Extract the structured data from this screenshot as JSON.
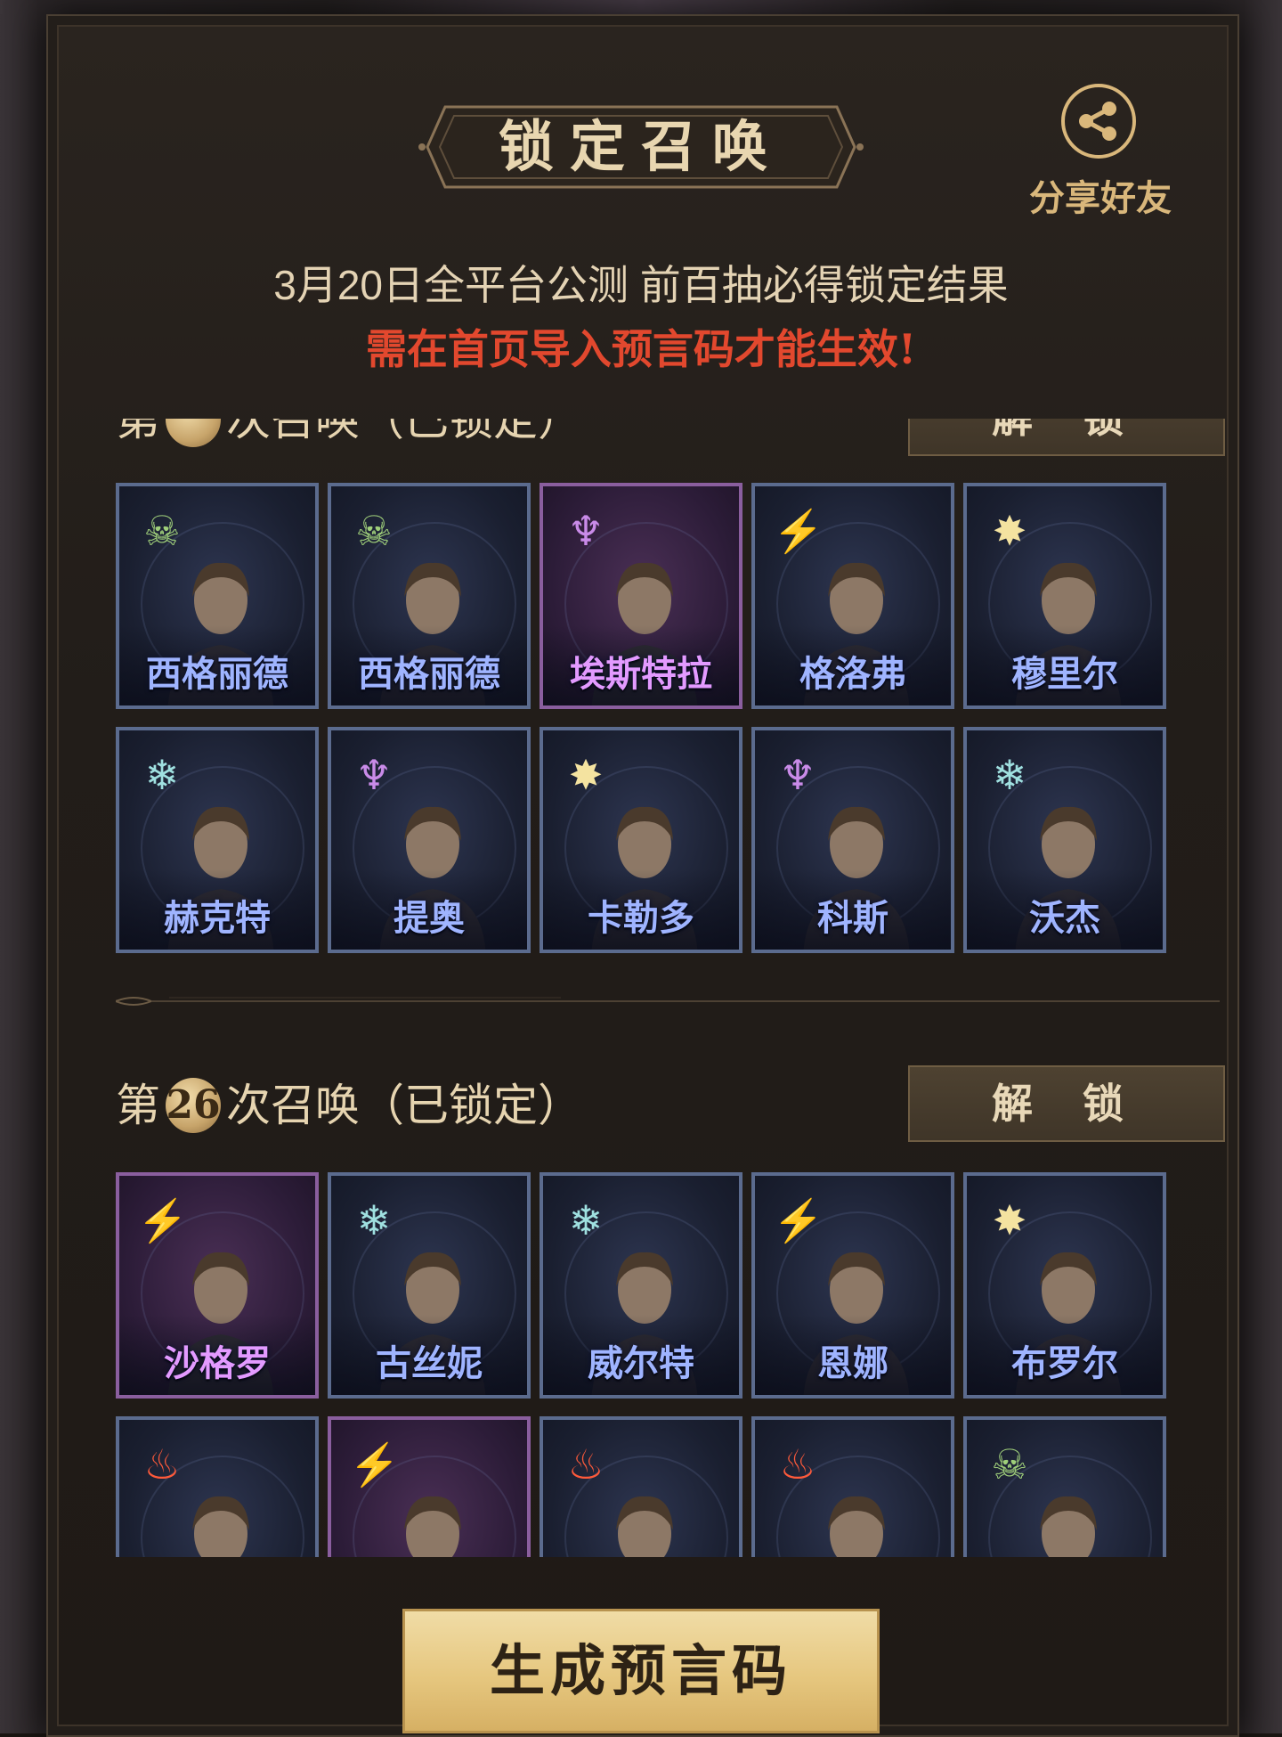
{
  "header": {
    "title": "锁定召唤",
    "share_label": "分享好友",
    "subtitle": "3月20日全平台公测 前百抽必得锁定结果",
    "notice": "需在首页导入预言码才能生效!"
  },
  "sections": [
    {
      "prefix": "第",
      "number": "",
      "suffix": "次召唤（已锁定）",
      "unlock_label": "解 锁",
      "rows": [
        [
          {
            "name": "西格丽德",
            "element": "skull",
            "rarity": "blue"
          },
          {
            "name": "西格丽德",
            "element": "skull",
            "rarity": "blue"
          },
          {
            "name": "埃斯特拉",
            "element": "demon",
            "rarity": "purple"
          },
          {
            "name": "格洛弗",
            "element": "lightning",
            "rarity": "blue"
          },
          {
            "name": "穆里尔",
            "element": "sun",
            "rarity": "blue"
          }
        ],
        [
          {
            "name": "赫克特",
            "element": "frost",
            "rarity": "blue"
          },
          {
            "name": "提奥",
            "element": "demon",
            "rarity": "blue"
          },
          {
            "name": "卡勒多",
            "element": "sun",
            "rarity": "blue"
          },
          {
            "name": "科斯",
            "element": "demon",
            "rarity": "blue"
          },
          {
            "name": "沃杰",
            "element": "frost",
            "rarity": "blue"
          }
        ]
      ]
    },
    {
      "prefix": "第",
      "number": "26",
      "suffix": "次召唤（已锁定）",
      "unlock_label": "解 锁",
      "rows": [
        [
          {
            "name": "沙格罗",
            "element": "lightning",
            "rarity": "purple"
          },
          {
            "name": "古丝妮",
            "element": "frost",
            "rarity": "blue"
          },
          {
            "name": "威尔特",
            "element": "frost",
            "rarity": "blue"
          },
          {
            "name": "恩娜",
            "element": "lightning",
            "rarity": "blue"
          },
          {
            "name": "布罗尔",
            "element": "sun",
            "rarity": "blue"
          }
        ],
        [
          {
            "name": "",
            "element": "fire",
            "rarity": "blue"
          },
          {
            "name": "",
            "element": "lightning",
            "rarity": "purple"
          },
          {
            "name": "",
            "element": "fire",
            "rarity": "blue"
          },
          {
            "name": "",
            "element": "fire",
            "rarity": "blue"
          },
          {
            "name": "",
            "element": "skull",
            "rarity": "blue"
          }
        ]
      ]
    }
  ],
  "footer": {
    "generate_label": "生成预言码"
  },
  "colors": {
    "accent_gold": "#d9b77b",
    "notice_red": "#e2482e",
    "name_blue": "#9fb4ff",
    "name_purple": "#e39aff",
    "element_skull": "#9fcf7a",
    "element_demon": "#c98be8",
    "element_lightning": "#5b9bff",
    "element_sun": "#f4e3a0",
    "element_frost": "#9fe0e0",
    "element_fire": "#ff5a3a"
  }
}
